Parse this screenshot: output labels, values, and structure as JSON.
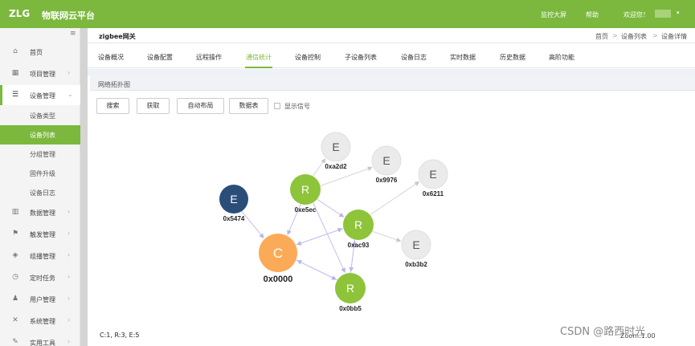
{
  "topbar": {
    "logo": "ZLG",
    "platform": "物联网云平台",
    "monitor": "监控大屏",
    "help": "帮助",
    "welcome": "欢迎您！",
    "bg_color": "#7bb83d"
  },
  "sidebar": {
    "collapse_icon": "≡",
    "items": [
      {
        "label": "首页",
        "icon": "home-icon"
      },
      {
        "label": "项目管理",
        "icon": "project-icon"
      },
      {
        "label": "设备管理",
        "icon": "device-icon"
      },
      {
        "label": "数据管理",
        "icon": "chart-icon"
      },
      {
        "label": "触发管理",
        "icon": "flag-icon"
      },
      {
        "label": "组播管理",
        "icon": "cube-icon"
      },
      {
        "label": "定时任务",
        "icon": "timer-icon"
      },
      {
        "label": "用户管理",
        "icon": "user-icon"
      },
      {
        "label": "系统管理",
        "icon": "wrench-icon"
      },
      {
        "label": "实用工具",
        "icon": "tool-icon"
      }
    ],
    "sub_items": [
      "设备类型",
      "设备列表",
      "分组管理",
      "固件升级",
      "设备日志"
    ]
  },
  "breadcrumb": {
    "title": "zigbee网关",
    "items": [
      "首页",
      "设备列表",
      "设备详情"
    ],
    "sep": ">"
  },
  "tabs": [
    "设备概况",
    "设备配置",
    "远程操作",
    "通信统计",
    "设备控制",
    "子设备列表",
    "设备日志",
    "实时数据",
    "历史数据",
    "高阶功能"
  ],
  "active_tab": "通信统计",
  "panel": {
    "title": "网络拓扑图",
    "buttons": [
      "搜索",
      "获取",
      "自动布局",
      "数据表"
    ],
    "checkbox_label": "显示信号"
  },
  "topology": {
    "nodes": [
      {
        "id": "0x0000",
        "letter": "C",
        "role": "coordinator",
        "color": "#fbab57"
      },
      {
        "id": "0x5474",
        "letter": "E",
        "role": "end-device",
        "color": "#2b4e79"
      },
      {
        "id": "0xe5ec",
        "letter": "R",
        "role": "router",
        "color": "#8dc43a"
      },
      {
        "id": "0xac93",
        "letter": "R",
        "role": "router",
        "color": "#8dc43a"
      },
      {
        "id": "0x0bb5",
        "letter": "R",
        "role": "router",
        "color": "#8dc43a"
      },
      {
        "id": "0xa2d2",
        "letter": "E",
        "role": "end-device",
        "color": "#ebebeb"
      },
      {
        "id": "0x9976",
        "letter": "E",
        "role": "end-device",
        "color": "#ebebeb"
      },
      {
        "id": "0x6211",
        "letter": "E",
        "role": "end-device",
        "color": "#ebebeb"
      },
      {
        "id": "0xb3b2",
        "letter": "E",
        "role": "end-device",
        "color": "#ebebeb"
      }
    ],
    "edges": [
      [
        "0x5474",
        "0x0000"
      ],
      [
        "0xe5ec",
        "0x0000"
      ],
      [
        "0xac93",
        "0x0000"
      ],
      [
        "0x0000",
        "0xac93"
      ],
      [
        "0x0bb5",
        "0x0000"
      ],
      [
        "0x0000",
        "0x0bb5"
      ],
      [
        "0xe5ec",
        "0xac93"
      ],
      [
        "0xe5ec",
        "0x0bb5"
      ],
      [
        "0xac93",
        "0x0bb5"
      ],
      [
        "0xe5ec",
        "0xa2d2"
      ],
      [
        "0xe5ec",
        "0x9976"
      ],
      [
        "0xac93",
        "0x6211"
      ],
      [
        "0xac93",
        "0xb3b2"
      ],
      [
        "0x0bb5",
        "0xac93"
      ]
    ],
    "summary": "C:1, R:3, E:5",
    "zoom": "Zoom:1.00"
  },
  "watermark": "CSDN @路西时光"
}
